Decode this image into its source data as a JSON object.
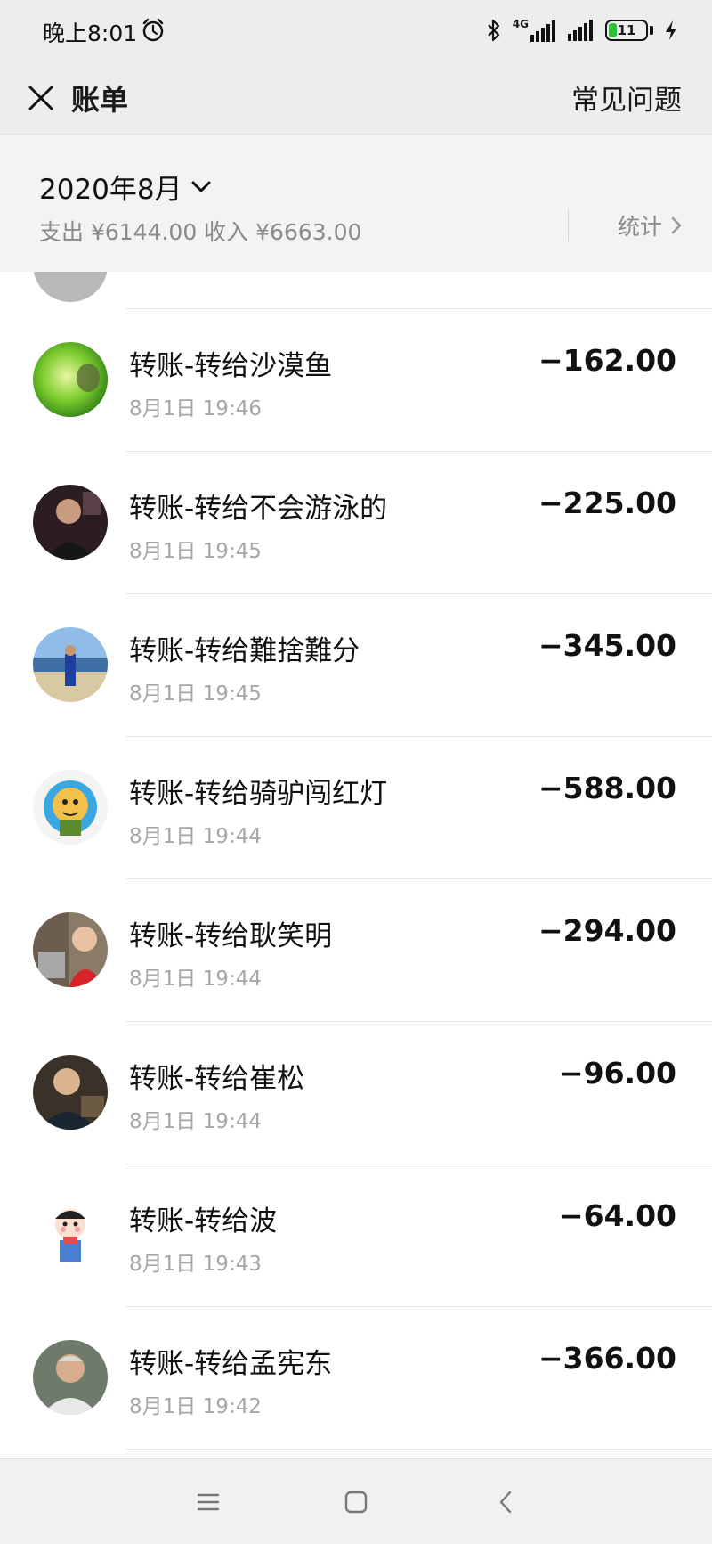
{
  "status_bar": {
    "time": "晚上8:01",
    "network": "4G",
    "battery": "11",
    "icons": [
      "alarm-icon",
      "bluetooth-icon",
      "signal-icon",
      "battery-icon",
      "charging-icon"
    ]
  },
  "nav": {
    "title": "账单",
    "faq_label": "常见问题",
    "close_icon": "close-icon"
  },
  "summary": {
    "month": "2020年8月",
    "totals": "支出 ¥6144.00 收入 ¥6663.00",
    "stats_label": "统计"
  },
  "transactions": [
    {
      "title": "转账-转给沙漠鱼",
      "time": "8月1日 19:46",
      "amount": "−162.00"
    },
    {
      "title": "转账-转给不会游泳的",
      "time": "8月1日 19:45",
      "amount": "−225.00"
    },
    {
      "title": "转账-转给難捨難分",
      "time": "8月1日 19:45",
      "amount": "−345.00"
    },
    {
      "title": "转账-转给骑驴闯红灯",
      "time": "8月1日 19:44",
      "amount": "−588.00"
    },
    {
      "title": "转账-转给耿笑明",
      "time": "8月1日 19:44",
      "amount": "−294.00"
    },
    {
      "title": "转账-转给崔松",
      "time": "8月1日 19:44",
      "amount": "−96.00"
    },
    {
      "title": "转账-转给波",
      "time": "8月1日 19:43",
      "amount": "−64.00"
    },
    {
      "title": "转账-转给孟宪东",
      "time": "8月1日 19:42",
      "amount": "−366.00"
    }
  ],
  "colors": {
    "background": "#ededed",
    "list_bg": "#ffffff",
    "secondary_text": "#a6a6a6",
    "battery_green": "#2fbf3c"
  }
}
